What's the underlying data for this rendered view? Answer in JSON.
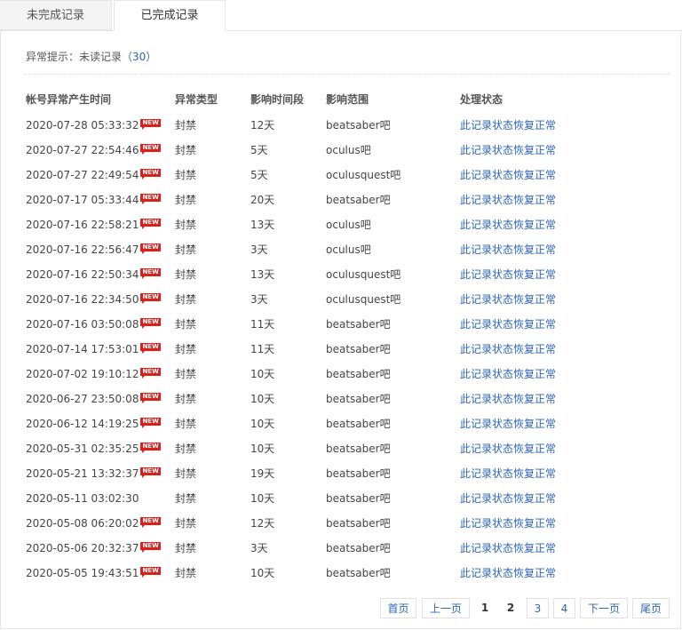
{
  "tabs": [
    {
      "label": "未完成记录"
    },
    {
      "label": "已完成记录"
    }
  ],
  "notice": {
    "prefix": "异常提示：未读记录",
    "count": "（30）"
  },
  "columns": [
    "帐号异常产生时间",
    "异常类型",
    "影响时间段",
    "影响范围",
    "处理状态"
  ],
  "badge_text": "NEW",
  "rows": [
    {
      "time": "2020-07-28 05:33:32",
      "new": true,
      "type": "封禁",
      "duration": "12天",
      "scope": "beatsaber吧",
      "status": "此记录状态恢复正常"
    },
    {
      "time": "2020-07-27 22:54:46",
      "new": true,
      "type": "封禁",
      "duration": "5天",
      "scope": "oculus吧",
      "status": "此记录状态恢复正常"
    },
    {
      "time": "2020-07-27 22:49:54",
      "new": true,
      "type": "封禁",
      "duration": "5天",
      "scope": "oculusquest吧",
      "status": "此记录状态恢复正常"
    },
    {
      "time": "2020-07-17 05:33:44",
      "new": true,
      "type": "封禁",
      "duration": "20天",
      "scope": "beatsaber吧",
      "status": "此记录状态恢复正常"
    },
    {
      "time": "2020-07-16 22:58:21",
      "new": true,
      "type": "封禁",
      "duration": "13天",
      "scope": "oculus吧",
      "status": "此记录状态恢复正常"
    },
    {
      "time": "2020-07-16 22:56:47",
      "new": true,
      "type": "封禁",
      "duration": "3天",
      "scope": "oculus吧",
      "status": "此记录状态恢复正常"
    },
    {
      "time": "2020-07-16 22:50:34",
      "new": true,
      "type": "封禁",
      "duration": "13天",
      "scope": "oculusquest吧",
      "status": "此记录状态恢复正常"
    },
    {
      "time": "2020-07-16 22:34:50",
      "new": true,
      "type": "封禁",
      "duration": "3天",
      "scope": "oculusquest吧",
      "status": "此记录状态恢复正常"
    },
    {
      "time": "2020-07-16 03:50:08",
      "new": true,
      "type": "封禁",
      "duration": "11天",
      "scope": "beatsaber吧",
      "status": "此记录状态恢复正常"
    },
    {
      "time": "2020-07-14 17:53:01",
      "new": true,
      "type": "封禁",
      "duration": "11天",
      "scope": "beatsaber吧",
      "status": "此记录状态恢复正常"
    },
    {
      "time": "2020-07-02 19:10:12",
      "new": true,
      "type": "封禁",
      "duration": "10天",
      "scope": "beatsaber吧",
      "status": "此记录状态恢复正常"
    },
    {
      "time": "2020-06-27 23:50:08",
      "new": true,
      "type": "封禁",
      "duration": "10天",
      "scope": "beatsaber吧",
      "status": "此记录状态恢复正常"
    },
    {
      "time": "2020-06-12 14:19:25",
      "new": true,
      "type": "封禁",
      "duration": "10天",
      "scope": "beatsaber吧",
      "status": "此记录状态恢复正常"
    },
    {
      "time": "2020-05-31 02:35:25",
      "new": true,
      "type": "封禁",
      "duration": "10天",
      "scope": "beatsaber吧",
      "status": "此记录状态恢复正常"
    },
    {
      "time": "2020-05-21 13:32:37",
      "new": true,
      "type": "封禁",
      "duration": "19天",
      "scope": "beatsaber吧",
      "status": "此记录状态恢复正常"
    },
    {
      "time": "2020-05-11 03:02:30",
      "new": false,
      "type": "封禁",
      "duration": "10天",
      "scope": "beatsaber吧",
      "status": "此记录状态恢复正常"
    },
    {
      "time": "2020-05-08 06:20:02",
      "new": true,
      "type": "封禁",
      "duration": "12天",
      "scope": "beatsaber吧",
      "status": "此记录状态恢复正常"
    },
    {
      "time": "2020-05-06 20:32:37",
      "new": true,
      "type": "封禁",
      "duration": "3天",
      "scope": "beatsaber吧",
      "status": "此记录状态恢复正常"
    },
    {
      "time": "2020-05-05 19:43:51",
      "new": true,
      "type": "封禁",
      "duration": "10天",
      "scope": "beatsaber吧",
      "status": "此记录状态恢复正常"
    }
  ],
  "pagination": {
    "first": "首页",
    "prev": "上一页",
    "pages": [
      "1",
      "2",
      "3",
      "4"
    ],
    "current": "2",
    "next": "下一页",
    "last": "尾页"
  }
}
